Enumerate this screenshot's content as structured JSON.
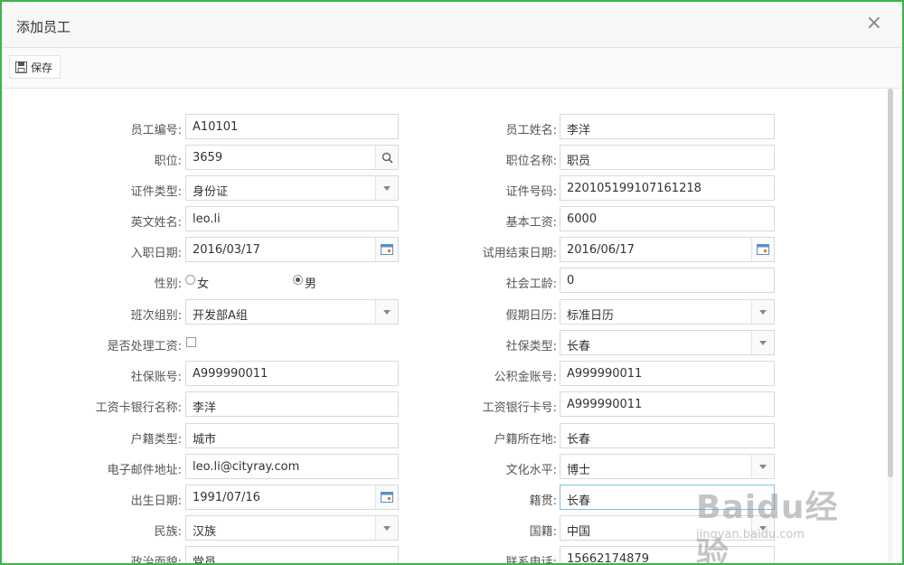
{
  "dialog": {
    "title": "添加员工"
  },
  "toolbar": {
    "save_label": "保存"
  },
  "fields": {
    "emp_no": {
      "label": "员工编号:",
      "value": "A10101"
    },
    "emp_name": {
      "label": "员工姓名:",
      "value": "李洋"
    },
    "position": {
      "label": "职位:",
      "value": "3659"
    },
    "position_name": {
      "label": "职位名称:",
      "value": "职员"
    },
    "id_type": {
      "label": "证件类型:",
      "value": "身份证"
    },
    "id_no": {
      "label": "证件号码:",
      "value": "220105199107161218"
    },
    "en_name": {
      "label": "英文姓名:",
      "value": "leo.li"
    },
    "base_salary": {
      "label": "基本工资:",
      "value": "6000"
    },
    "hire_date": {
      "label": "入职日期:",
      "value": "2016/03/17"
    },
    "probation_end": {
      "label": "试用结束日期:",
      "value": "2016/06/17"
    },
    "gender": {
      "label": "性别:",
      "opt_female": "女",
      "opt_male": "男",
      "selected": "男"
    },
    "social_years": {
      "label": "社会工龄:",
      "value": "0"
    },
    "shift_group": {
      "label": "班次组别:",
      "value": "开发部A组"
    },
    "holiday_cal": {
      "label": "假期日历:",
      "value": "标准日历"
    },
    "process_salary": {
      "label": "是否处理工资:",
      "checked": false
    },
    "insurance_type": {
      "label": "社保类型:",
      "value": "长春"
    },
    "insurance_acct": {
      "label": "社保账号:",
      "value": "A999990011"
    },
    "fund_acct": {
      "label": "公积金账号:",
      "value": "A999990011"
    },
    "bank_name": {
      "label": "工资卡银行名称:",
      "value": "李洋"
    },
    "bank_card": {
      "label": "工资银行卡号:",
      "value": "A999990011"
    },
    "hukou_type": {
      "label": "户籍类型:",
      "value": "城市"
    },
    "hukou_place": {
      "label": "户籍所在地:",
      "value": "长春"
    },
    "email": {
      "label": "电子邮件地址:",
      "value": "leo.li@cityray.com"
    },
    "education": {
      "label": "文化水平:",
      "value": "博士"
    },
    "birth_date": {
      "label": "出生日期:",
      "value": "1991/07/16"
    },
    "native_place": {
      "label": "籍贯:",
      "value": "长春"
    },
    "ethnicity": {
      "label": "民族:",
      "value": "汉族"
    },
    "nationality": {
      "label": "国籍:",
      "value": "中国"
    },
    "political": {
      "label": "政治面貌:",
      "value": "党员"
    },
    "phone": {
      "label": "联系电话:",
      "value": "15662174879"
    }
  },
  "watermark": {
    "text": "Baidu经验",
    "url": "jingyan.baidu.com"
  },
  "colors": {
    "frame_border": "#3bb54a",
    "focus_border": "#7fbfe8"
  }
}
